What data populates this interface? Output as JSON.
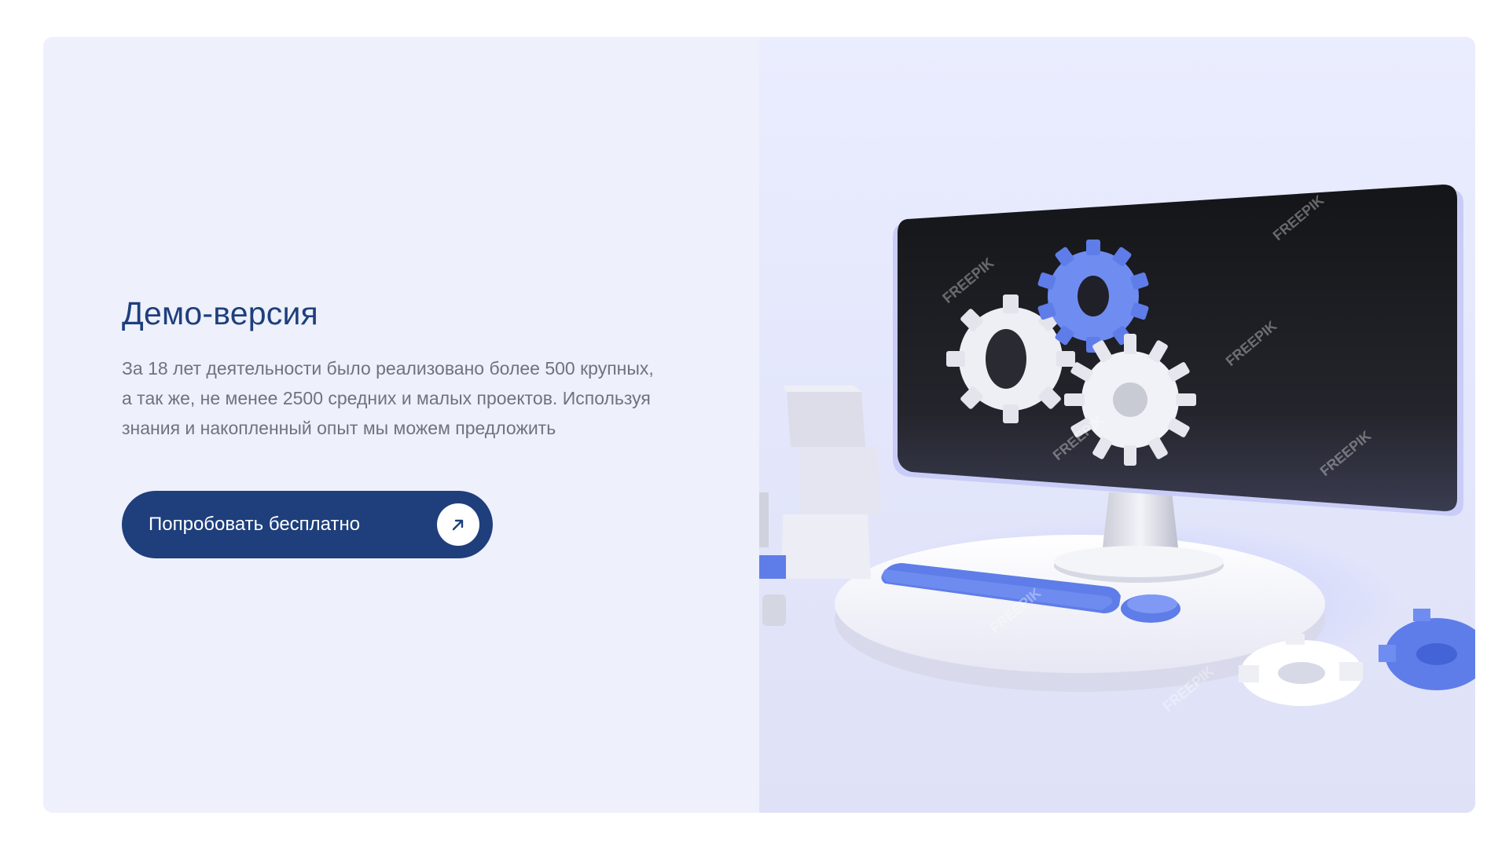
{
  "demo": {
    "title": "Демо-версия",
    "description": "За 18 лет деятельности было реализовано более 500 крупных,\nа так же, не менее 2500 средних и малых проектов. Используя\nзнания и накопленный опыт мы можем предложить",
    "cta_label": "Попробовать бесплатно",
    "cta_icon": "arrow-up-right-icon"
  },
  "illustration": {
    "subject": "computer-gears-illustration",
    "watermark": "FREEPIK"
  },
  "colors": {
    "accent": "#1e3f7c",
    "card_background": "#eef0fb",
    "body_text": "#6f7380",
    "gear_blue": "#6f8cf0"
  }
}
